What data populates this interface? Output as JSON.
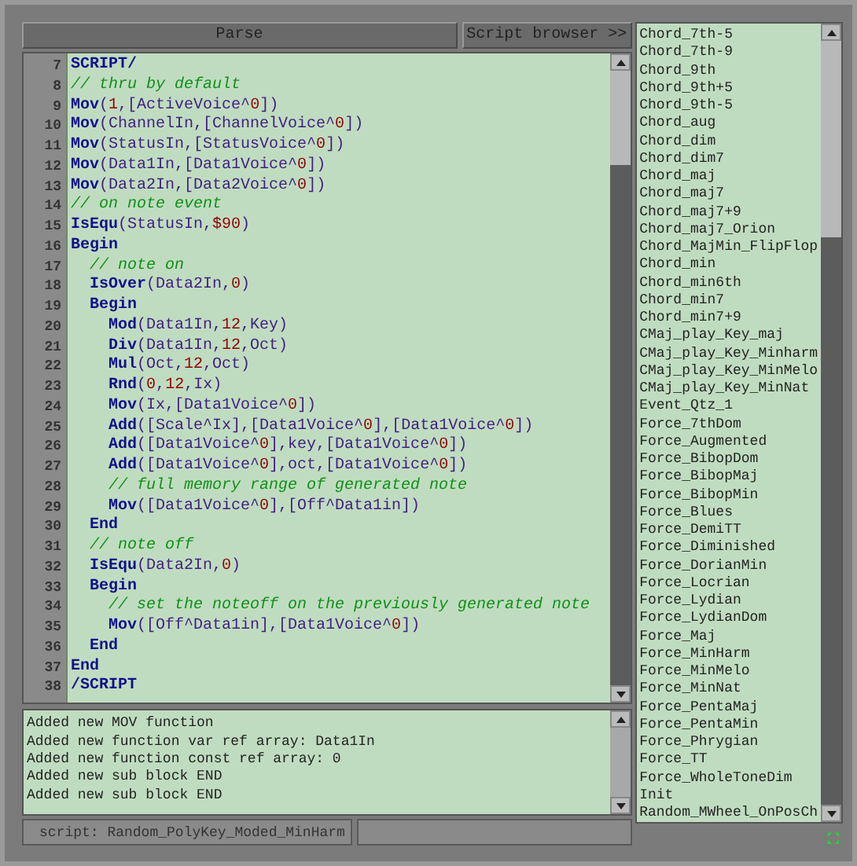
{
  "toolbar": {
    "parse_button": "Parse",
    "browser_button": "Script browser >>"
  },
  "editor": {
    "lines": [
      {
        "number": "7",
        "tokens": [
          {
            "kind": "keyword",
            "text": "SCRIPT/"
          }
        ]
      },
      {
        "number": "8",
        "tokens": [
          {
            "kind": "comment",
            "text": "// thru by default"
          }
        ]
      },
      {
        "number": "9",
        "tokens": [
          {
            "kind": "keyword",
            "text": "Mov"
          },
          {
            "kind": "arg",
            "text": "("
          },
          {
            "kind": "number",
            "text": "1"
          },
          {
            "kind": "arg",
            "text": ",[ActiveVoice^"
          },
          {
            "kind": "number",
            "text": "0"
          },
          {
            "kind": "arg",
            "text": "])"
          }
        ]
      },
      {
        "number": "10",
        "tokens": [
          {
            "kind": "keyword",
            "text": "Mov"
          },
          {
            "kind": "arg",
            "text": "(ChannelIn,[ChannelVoice^"
          },
          {
            "kind": "number",
            "text": "0"
          },
          {
            "kind": "arg",
            "text": "])"
          }
        ]
      },
      {
        "number": "11",
        "tokens": [
          {
            "kind": "keyword",
            "text": "Mov"
          },
          {
            "kind": "arg",
            "text": "(StatusIn,[StatusVoice^"
          },
          {
            "kind": "number",
            "text": "0"
          },
          {
            "kind": "arg",
            "text": "])"
          }
        ]
      },
      {
        "number": "12",
        "tokens": [
          {
            "kind": "keyword",
            "text": "Mov"
          },
          {
            "kind": "arg",
            "text": "(Data1In,[Data1Voice^"
          },
          {
            "kind": "number",
            "text": "0"
          },
          {
            "kind": "arg",
            "text": "])"
          }
        ]
      },
      {
        "number": "13",
        "tokens": [
          {
            "kind": "keyword",
            "text": "Mov"
          },
          {
            "kind": "arg",
            "text": "(Data2In,[Data2Voice^"
          },
          {
            "kind": "number",
            "text": "0"
          },
          {
            "kind": "arg",
            "text": "])"
          }
        ]
      },
      {
        "number": "14",
        "tokens": [
          {
            "kind": "comment",
            "text": "// on note event"
          }
        ]
      },
      {
        "number": "15",
        "tokens": [
          {
            "kind": "keyword",
            "text": "IsEqu"
          },
          {
            "kind": "arg",
            "text": "(StatusIn,"
          },
          {
            "kind": "number",
            "text": "$90"
          },
          {
            "kind": "arg",
            "text": ")"
          }
        ]
      },
      {
        "number": "16",
        "tokens": [
          {
            "kind": "keyword",
            "text": "Begin"
          }
        ]
      },
      {
        "number": "17",
        "tokens": [
          {
            "kind": "comment",
            "text": "  // note on"
          }
        ]
      },
      {
        "number": "18",
        "tokens": [
          {
            "kind": "keyword",
            "text": "  IsOver"
          },
          {
            "kind": "arg",
            "text": "(Data2In,"
          },
          {
            "kind": "number",
            "text": "0"
          },
          {
            "kind": "arg",
            "text": ")"
          }
        ]
      },
      {
        "number": "19",
        "tokens": [
          {
            "kind": "keyword",
            "text": "  Begin"
          }
        ]
      },
      {
        "number": "20",
        "tokens": [
          {
            "kind": "keyword",
            "text": "    Mod"
          },
          {
            "kind": "arg",
            "text": "(Data1In,"
          },
          {
            "kind": "number",
            "text": "12"
          },
          {
            "kind": "arg",
            "text": ",Key)"
          }
        ]
      },
      {
        "number": "21",
        "tokens": [
          {
            "kind": "keyword",
            "text": "    Div"
          },
          {
            "kind": "arg",
            "text": "(Data1In,"
          },
          {
            "kind": "number",
            "text": "12"
          },
          {
            "kind": "arg",
            "text": ",Oct)"
          }
        ]
      },
      {
        "number": "22",
        "tokens": [
          {
            "kind": "keyword",
            "text": "    Mul"
          },
          {
            "kind": "arg",
            "text": "(Oct,"
          },
          {
            "kind": "number",
            "text": "12"
          },
          {
            "kind": "arg",
            "text": ",Oct)"
          }
        ]
      },
      {
        "number": "23",
        "tokens": [
          {
            "kind": "keyword",
            "text": "    Rnd"
          },
          {
            "kind": "arg",
            "text": "("
          },
          {
            "kind": "number",
            "text": "0"
          },
          {
            "kind": "arg",
            "text": ","
          },
          {
            "kind": "number",
            "text": "12"
          },
          {
            "kind": "arg",
            "text": ",Ix)"
          }
        ]
      },
      {
        "number": "24",
        "tokens": [
          {
            "kind": "keyword",
            "text": "    Mov"
          },
          {
            "kind": "arg",
            "text": "(Ix,[Data1Voice^"
          },
          {
            "kind": "number",
            "text": "0"
          },
          {
            "kind": "arg",
            "text": "])"
          }
        ]
      },
      {
        "number": "25",
        "tokens": [
          {
            "kind": "keyword",
            "text": "    Add"
          },
          {
            "kind": "arg",
            "text": "([Scale^Ix],[Data1Voice^"
          },
          {
            "kind": "number",
            "text": "0"
          },
          {
            "kind": "arg",
            "text": "],[Data1Voice^"
          },
          {
            "kind": "number",
            "text": "0"
          },
          {
            "kind": "arg",
            "text": "])"
          }
        ]
      },
      {
        "number": "26",
        "tokens": [
          {
            "kind": "keyword",
            "text": "    Add"
          },
          {
            "kind": "arg",
            "text": "([Data1Voice^"
          },
          {
            "kind": "number",
            "text": "0"
          },
          {
            "kind": "arg",
            "text": "],key,[Data1Voice^"
          },
          {
            "kind": "number",
            "text": "0"
          },
          {
            "kind": "arg",
            "text": "])"
          }
        ]
      },
      {
        "number": "27",
        "tokens": [
          {
            "kind": "keyword",
            "text": "    Add"
          },
          {
            "kind": "arg",
            "text": "([Data1Voice^"
          },
          {
            "kind": "number",
            "text": "0"
          },
          {
            "kind": "arg",
            "text": "],oct,[Data1Voice^"
          },
          {
            "kind": "number",
            "text": "0"
          },
          {
            "kind": "arg",
            "text": "])"
          }
        ]
      },
      {
        "number": "28",
        "tokens": [
          {
            "kind": "comment",
            "text": "    // full memory range of generated note"
          }
        ]
      },
      {
        "number": "29",
        "tokens": [
          {
            "kind": "keyword",
            "text": "    Mov"
          },
          {
            "kind": "arg",
            "text": "([Data1Voice^"
          },
          {
            "kind": "number",
            "text": "0"
          },
          {
            "kind": "arg",
            "text": "],[Off^Data1in])"
          }
        ]
      },
      {
        "number": "30",
        "tokens": [
          {
            "kind": "keyword",
            "text": "  End"
          }
        ]
      },
      {
        "number": "31",
        "tokens": [
          {
            "kind": "comment",
            "text": "  // note off"
          }
        ]
      },
      {
        "number": "32",
        "tokens": [
          {
            "kind": "keyword",
            "text": "  IsEqu"
          },
          {
            "kind": "arg",
            "text": "(Data2In,"
          },
          {
            "kind": "number",
            "text": "0"
          },
          {
            "kind": "arg",
            "text": ")"
          }
        ]
      },
      {
        "number": "33",
        "tokens": [
          {
            "kind": "keyword",
            "text": "  Begin"
          }
        ]
      },
      {
        "number": "34",
        "tokens": [
          {
            "kind": "comment",
            "text": "    // set the noteoff on the previously generated note"
          }
        ]
      },
      {
        "number": "35",
        "tokens": [
          {
            "kind": "keyword",
            "text": "    Mov"
          },
          {
            "kind": "arg",
            "text": "([Off^Data1in],[Data1Voice^"
          },
          {
            "kind": "number",
            "text": "0"
          },
          {
            "kind": "arg",
            "text": "])"
          }
        ]
      },
      {
        "number": "36",
        "tokens": [
          {
            "kind": "keyword",
            "text": "  End"
          }
        ]
      },
      {
        "number": "37",
        "tokens": [
          {
            "kind": "keyword",
            "text": "End"
          }
        ]
      },
      {
        "number": "38",
        "tokens": [
          {
            "kind": "keyword",
            "text": "/SCRIPT"
          }
        ]
      }
    ]
  },
  "log": [
    "Added new MOV function",
    "Added new function var ref array: Data1In",
    "Added new function const ref array: 0",
    "Added new sub block END",
    "Added new sub block END"
  ],
  "status_bar": {
    "script": "script: Random_PolyKey_Moded_MinHarm"
  },
  "script_list": [
    "Chord_7th-5",
    "Chord_7th-9",
    "Chord_9th",
    "Chord_9th+5",
    "Chord_9th-5",
    "Chord_aug",
    "Chord_dim",
    "Chord_dim7",
    "Chord_maj",
    "Chord_maj7",
    "Chord_maj7+9",
    "Chord_maj7_Orion",
    "Chord_MajMin_FlipFlop",
    "Chord_min",
    "Chord_min6th",
    "Chord_min7",
    "Chord_min7+9",
    "CMaj_play_Key_maj",
    "CMaj_play_Key_Minharm",
    "CMaj_play_Key_MinMelo",
    "CMaj_play_Key_MinNat",
    "Event_Qtz_1",
    "Force_7thDom",
    "Force_Augmented",
    "Force_BibopDom",
    "Force_BibopMaj",
    "Force_BibopMin",
    "Force_Blues",
    "Force_DemiTT",
    "Force_Diminished",
    "Force_DorianMin",
    "Force_Locrian",
    "Force_Lydian",
    "Force_LydianDom",
    "Force_Maj",
    "Force_MinHarm",
    "Force_MinMelo",
    "Force_MinNat",
    "Force_PentaMaj",
    "Force_PentaMin",
    "Force_Phrygian",
    "Force_TT",
    "Force_WholeToneDim",
    "Init",
    "Random_MWheel_OnPosCh"
  ]
}
